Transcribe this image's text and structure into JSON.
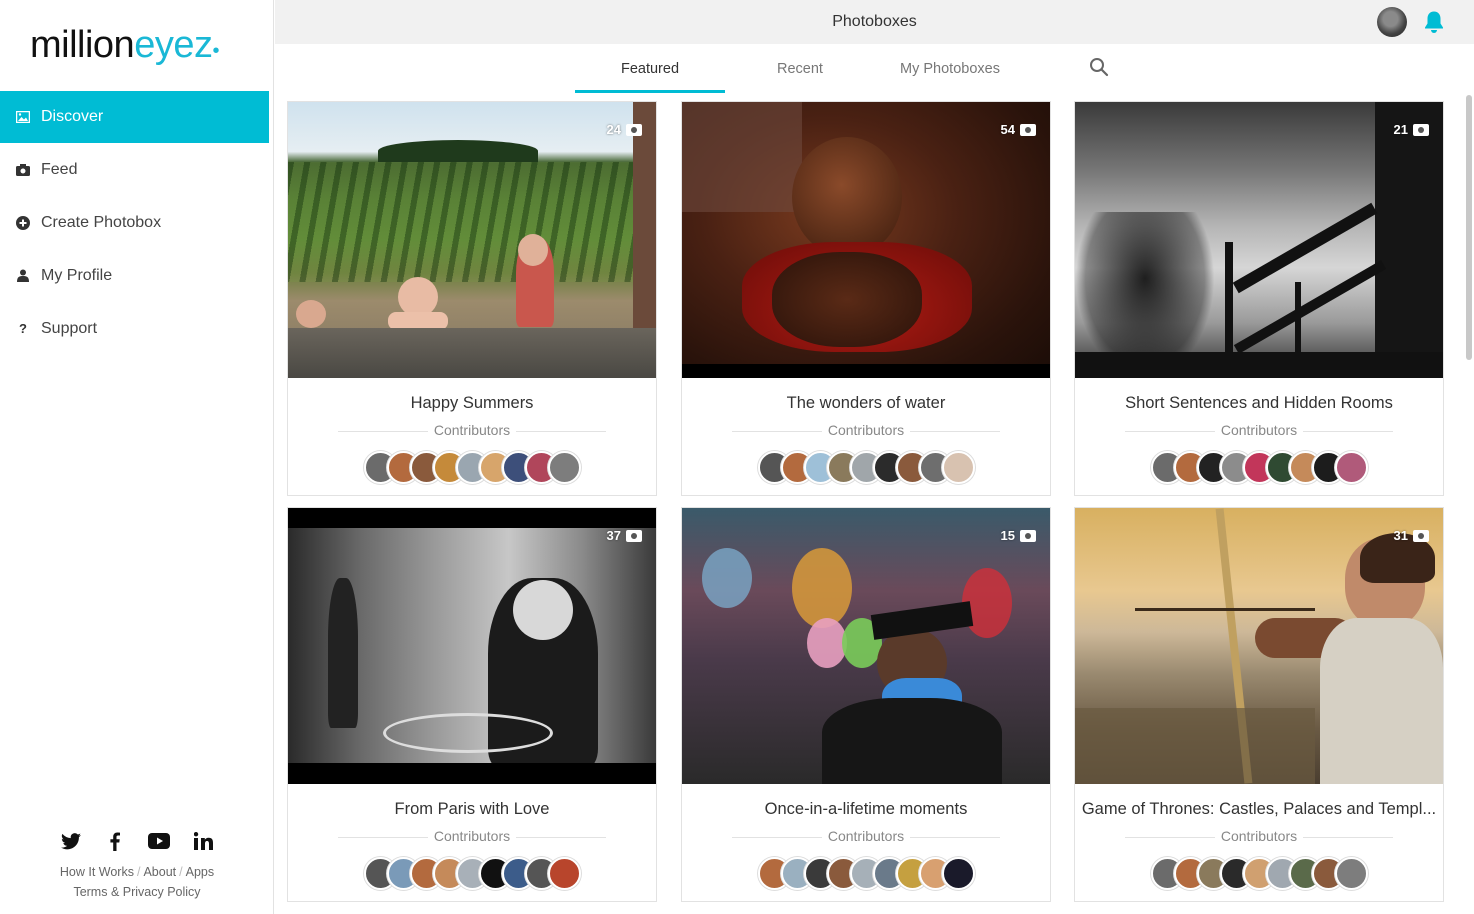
{
  "brand": {
    "logo_part1": "million",
    "logo_part2": "eyez",
    "accent": "#00bcd4"
  },
  "sidebar": {
    "items": [
      {
        "label": "Discover",
        "icon": "image-icon",
        "active": true
      },
      {
        "label": "Feed",
        "icon": "camera-icon",
        "active": false
      },
      {
        "label": "Create Photobox",
        "icon": "plus-circle-icon",
        "active": false
      },
      {
        "label": "My Profile",
        "icon": "user-icon",
        "active": false
      },
      {
        "label": "Support",
        "icon": "question-icon",
        "active": false
      }
    ],
    "social": [
      "twitter-icon",
      "facebook-icon",
      "youtube-icon",
      "linkedin-icon"
    ],
    "links": {
      "how": "How It Works",
      "about": "About",
      "apps": "Apps",
      "terms": "Terms & Privacy Policy"
    }
  },
  "header": {
    "title": "Photoboxes"
  },
  "tabs": [
    {
      "label": "Featured",
      "active": true
    },
    {
      "label": "Recent",
      "active": false
    },
    {
      "label": "My Photoboxes",
      "active": false
    }
  ],
  "contributors_label": "Contributors",
  "cards": [
    {
      "title": "Happy Summers",
      "count": "24"
    },
    {
      "title": "The wonders of water",
      "count": "54"
    },
    {
      "title": "Short Sentences and Hidden Rooms",
      "count": "21"
    },
    {
      "title": "From Paris with Love",
      "count": "37"
    },
    {
      "title": "Once-in-a-lifetime moments",
      "count": "15"
    },
    {
      "title": "Game of Thrones: Castles, Palaces and Templ...",
      "count": "31"
    }
  ]
}
